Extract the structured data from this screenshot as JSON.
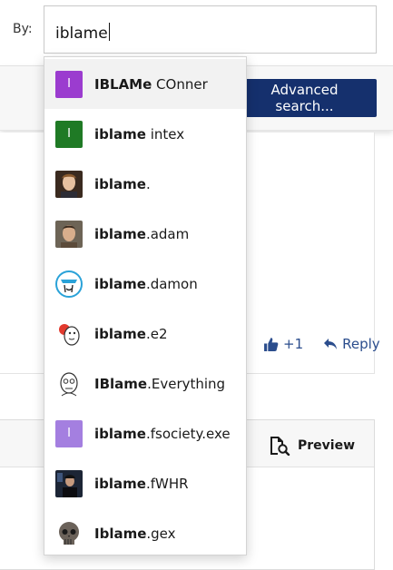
{
  "search": {
    "by_label": "By:",
    "value": "iblame"
  },
  "toolbar": {
    "advanced_search_label": "Advanced search..."
  },
  "post": {
    "like_count": "+1",
    "reply_label": "Reply"
  },
  "editor": {
    "preview_label": "Preview"
  },
  "colors": {
    "accent": "#15306d",
    "link": "#2b4d8d",
    "purple_avatar": "#9b3ccf",
    "green_avatar": "#1f7a25",
    "lilac_avatar": "#a47fe0"
  },
  "suggestions": [
    {
      "match": "IBLAMe",
      "rest": " COnner",
      "avatar_type": "letter",
      "avatar_letter": "I",
      "avatar_color": "#9b3ccf"
    },
    {
      "match": "iblame",
      "rest": " intex",
      "avatar_type": "letter",
      "avatar_letter": "I",
      "avatar_color": "#1f7a25"
    },
    {
      "match": "iblame",
      "rest": ".",
      "avatar_type": "photo",
      "avatar_icon": "portrait-photo-icon"
    },
    {
      "match": "iblame",
      "rest": ".adam",
      "avatar_type": "photo",
      "avatar_icon": "portrait-photo-icon"
    },
    {
      "match": "iblame",
      "rest": ".damon",
      "avatar_type": "drawing",
      "avatar_icon": "sketch-face-icon"
    },
    {
      "match": "iblame",
      "rest": ".e2",
      "avatar_type": "drawing",
      "avatar_icon": "cartoon-figure-icon"
    },
    {
      "match": "IBlame",
      "rest": ".Everything",
      "avatar_type": "drawing",
      "avatar_icon": "meme-face-icon"
    },
    {
      "match": "iblame",
      "rest": ".fsociety.exe",
      "avatar_type": "letter",
      "avatar_letter": "I",
      "avatar_color": "#a47fe0"
    },
    {
      "match": "iblame",
      "rest": ".fWHR",
      "avatar_type": "photo",
      "avatar_icon": "dark-photo-icon"
    },
    {
      "match": "Iblame",
      "rest": ".gex",
      "avatar_type": "photo",
      "avatar_icon": "skull-icon"
    }
  ]
}
